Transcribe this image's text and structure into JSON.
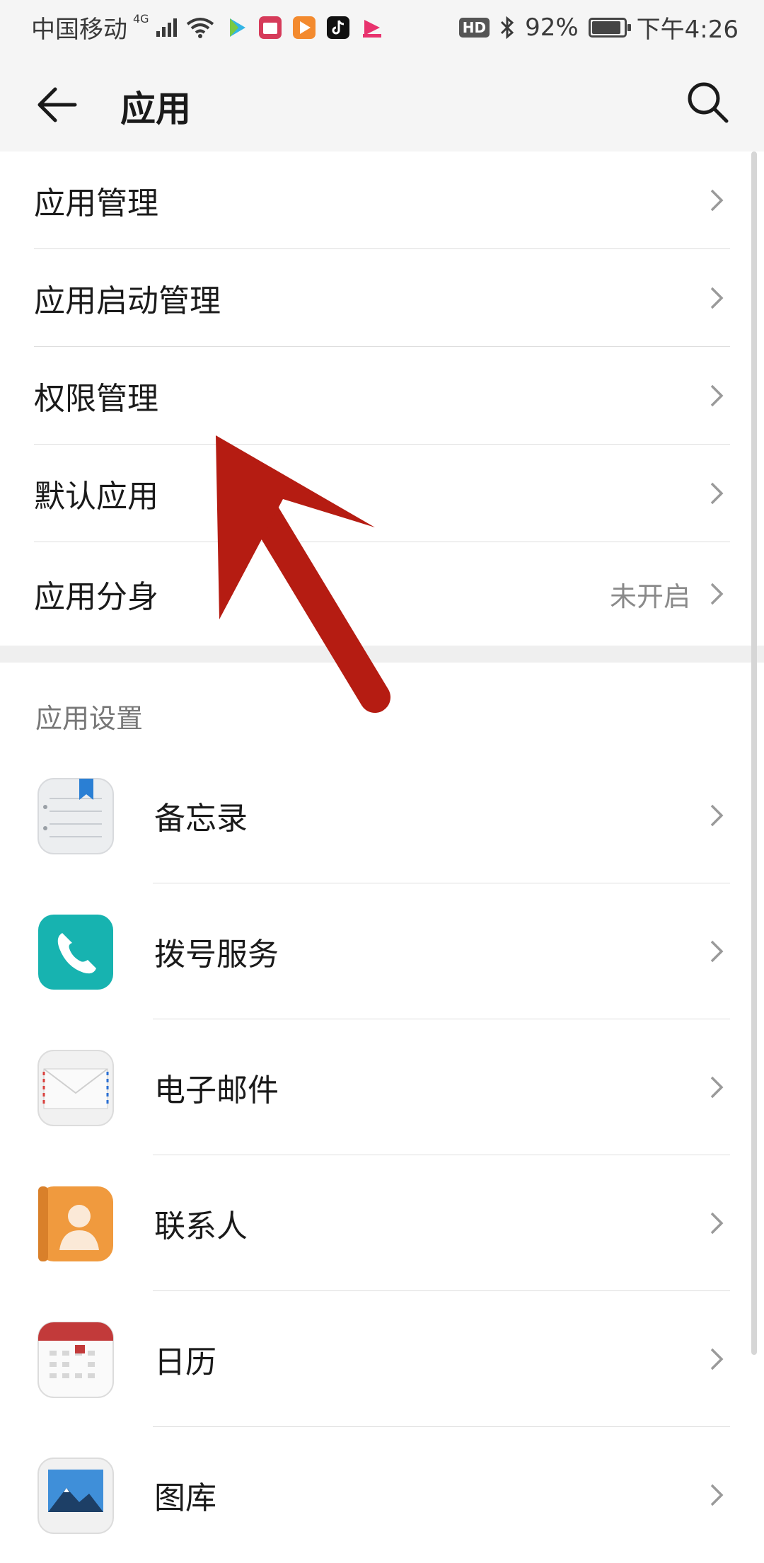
{
  "status_bar": {
    "carrier": "中国移动",
    "network_badge": "4G",
    "hd_badge": "HD",
    "battery_percent": "92%",
    "battery_level": 0.92,
    "time": "下午4:26"
  },
  "header": {
    "title": "应用"
  },
  "menu": {
    "items": [
      {
        "label": "应用管理",
        "value": ""
      },
      {
        "label": "应用启动管理",
        "value": ""
      },
      {
        "label": "权限管理",
        "value": ""
      },
      {
        "label": "默认应用",
        "value": ""
      },
      {
        "label": "应用分身",
        "value": "未开启"
      }
    ]
  },
  "settings_section": {
    "title": "应用设置",
    "apps": [
      {
        "name": "备忘录",
        "icon": "notepad-icon"
      },
      {
        "name": "拨号服务",
        "icon": "phone-icon"
      },
      {
        "name": "电子邮件",
        "icon": "envelope-icon"
      },
      {
        "name": "联系人",
        "icon": "contacts-icon"
      },
      {
        "name": "日历",
        "icon": "calendar-icon"
      },
      {
        "name": "图库",
        "icon": "gallery-icon"
      }
    ]
  },
  "colors": {
    "annotation_arrow": "#b51c12",
    "dialer_teal": "#17b3b0",
    "contacts_orange": "#f09a3e",
    "calendar_red": "#c23a3a"
  }
}
